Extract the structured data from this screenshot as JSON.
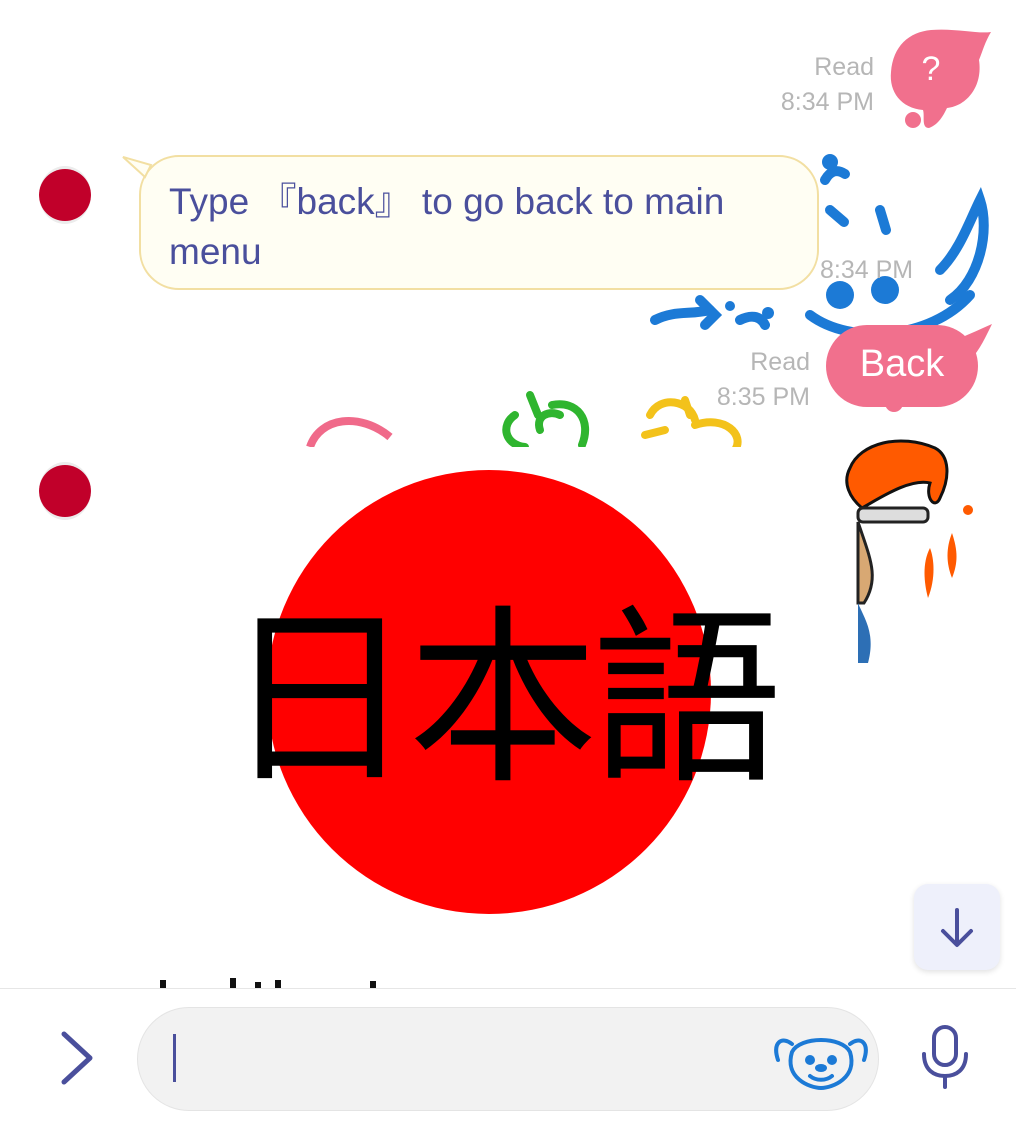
{
  "messages": {
    "sent_question": {
      "text": "?",
      "status": "Read",
      "time": "8:34 PM"
    },
    "bot_reply": {
      "text": "Type 『back』 to go back to main menu",
      "time": "8:34 PM"
    },
    "sent_back": {
      "text": "Back",
      "status": "Read",
      "time": "8:35 PM"
    },
    "language_sticker": {
      "text": "日本語"
    },
    "partial_caption": {
      "text": ""
    }
  },
  "composer": {
    "input_value": "",
    "placeholder": ""
  },
  "icons": {
    "expand": "chevron-right-icon",
    "sticker": "stitch-sticker-icon",
    "mic": "microphone-icon",
    "scroll_down": "arrow-down-icon"
  },
  "colors": {
    "sent_bubble": "#f1708d",
    "received_bubble_bg": "#fffef3",
    "received_text": "#4a4f9c",
    "avatar": "#c1002a",
    "accent": "#4a4f9c",
    "sticker_red": "#ff0000"
  }
}
